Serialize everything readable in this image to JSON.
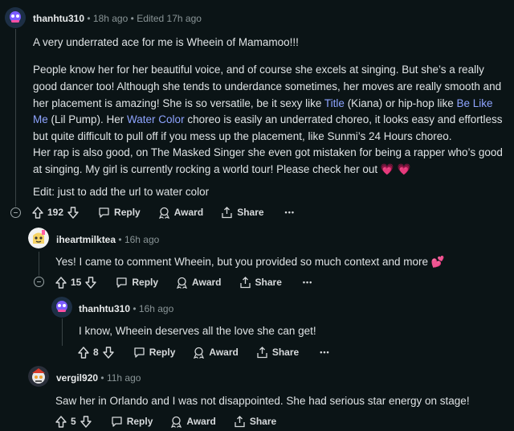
{
  "comments": [
    {
      "username": "thanhtu310",
      "age": "18h ago",
      "edited": "Edited 17h ago",
      "paragraphs": [
        {
          "parts": [
            {
              "text": "A very underrated ace for me is Wheein of Mamamoo!!!"
            }
          ]
        },
        {
          "parts": [
            {
              "text": "People know her for her beautiful voice, and of course she excels at singing. But she’s a really good dancer too! Although she tends to underdance sometimes, her moves are really smooth and her placement is amazing! She is so versatile, be it sexy like "
            },
            {
              "text": "Title",
              "link": true
            },
            {
              "text": " (Kiana) or hip-hop like "
            },
            {
              "text": "Be Like Me",
              "link": true
            },
            {
              "text": " (Lil Pump). Her "
            },
            {
              "text": "Water Color",
              "link": true
            },
            {
              "text": " choreo is easily an underrated choreo, it looks easy and effortless but quite difficult to pull off if you mess up the placement, like Sunmi’s 24 Hours choreo."
            }
          ]
        },
        {
          "parts": [
            {
              "text": "Her rap is also good, on The Masked Singer she even got mistaken for being a rapper who’s good at singing. My girl is currently rocking a world tour! Please check her out 💗 💗"
            }
          ]
        },
        {
          "parts": [
            {
              "text": "Edit: just to add the url to water color"
            }
          ]
        }
      ],
      "votes": "192"
    },
    {
      "username": "iheartmilktea",
      "age": "16h ago",
      "paragraphs": [
        {
          "parts": [
            {
              "text": "Yes! I came to comment Wheein, but you provided so much context and more 💕"
            }
          ]
        }
      ],
      "votes": "15"
    },
    {
      "username": "thanhtu310",
      "age": "16h ago",
      "paragraphs": [
        {
          "parts": [
            {
              "text": "I know, Wheein deserves all the love she can get!"
            }
          ]
        }
      ],
      "votes": "8"
    },
    {
      "username": "vergil920",
      "age": "11h ago",
      "paragraphs": [
        {
          "parts": [
            {
              "text": "Saw her in Orlando and I was not disappointed. She had serious star energy on stage!"
            }
          ]
        }
      ],
      "votes": "5"
    }
  ],
  "labels": {
    "reply": "Reply",
    "award": "Award",
    "share": "Share",
    "more": "•••",
    "dot": "•"
  },
  "colors": {
    "background": "#0b1416",
    "link": "#8ea4ff",
    "meta": "#8a9597",
    "text": "#dfe3e5"
  }
}
